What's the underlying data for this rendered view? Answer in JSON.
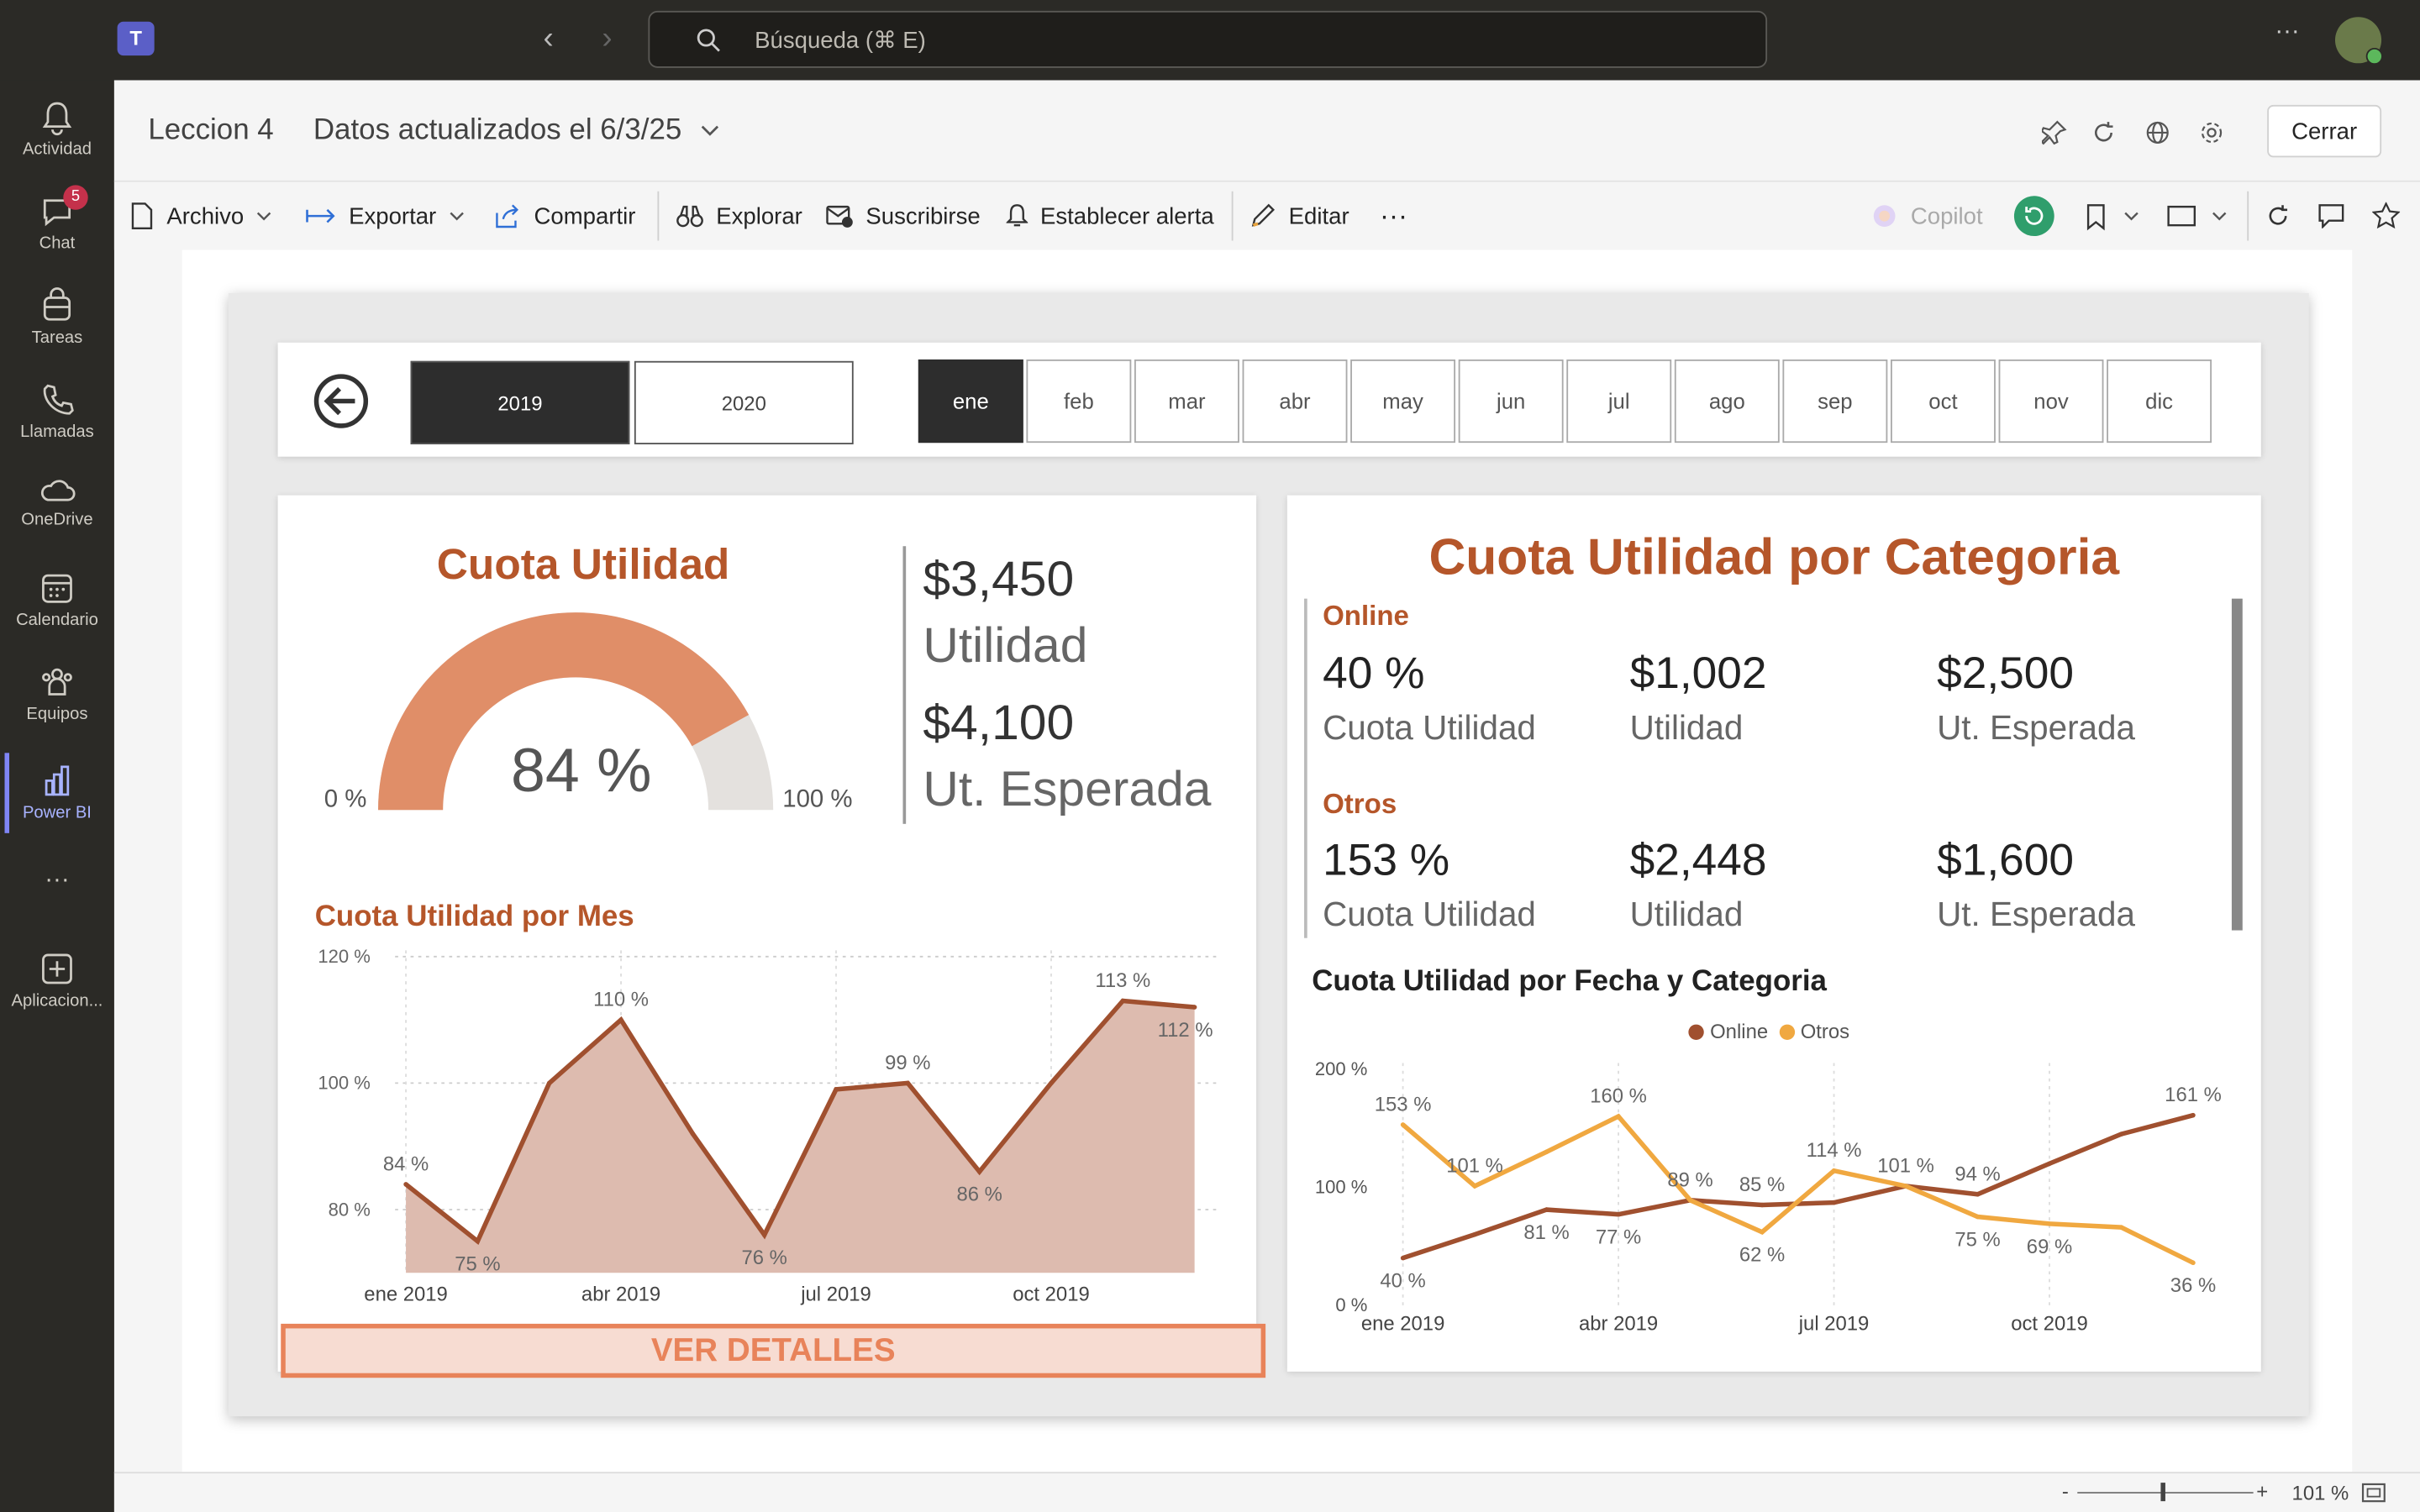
{
  "topbar": {
    "search_placeholder": "Búsqueda (⌘ E)",
    "more": "···"
  },
  "rail": {
    "chat_badge": "5",
    "items": [
      {
        "label": "Actividad"
      },
      {
        "label": "Chat"
      },
      {
        "label": "Tareas"
      },
      {
        "label": "Llamadas"
      },
      {
        "label": "OneDrive"
      },
      {
        "label": "Calendario"
      },
      {
        "label": "Equipos"
      },
      {
        "label": "Power BI"
      },
      {
        "label": "···"
      },
      {
        "label": "Aplicacion..."
      }
    ]
  },
  "header": {
    "title": "Leccion 4",
    "updated": "Datos actualizados el 6/3/25",
    "close_label": "Cerrar"
  },
  "toolbar": {
    "archivo": "Archivo",
    "exportar": "Exportar",
    "compartir": "Compartir",
    "explorar": "Explorar",
    "suscribirse": "Suscribirse",
    "alerta": "Establecer alerta",
    "editar": "Editar",
    "more": "···",
    "copilot": "Copilot"
  },
  "slicer": {
    "years": [
      "2019",
      "2020"
    ],
    "months": [
      "ene",
      "feb",
      "mar",
      "abr",
      "may",
      "jun",
      "jul",
      "ago",
      "sep",
      "oct",
      "nov",
      "dic"
    ],
    "selected_year": "2019",
    "selected_month": "ene"
  },
  "gauge": {
    "title": "Cuota Utilidad",
    "value_label": "84 %",
    "min_label": "0 %",
    "max_label": "100 %",
    "fraction": 0.84
  },
  "kpis": {
    "utilidad_value": "$3,450",
    "utilidad_label": "Utilidad",
    "esperada_value": "$4,100",
    "esperada_label": "Ut. Esperada"
  },
  "categoria": {
    "title": "Cuota Utilidad por Categoria",
    "online": {
      "name": "Online",
      "cuota": "40 %",
      "cuota_label": "Cuota Utilidad",
      "utilidad": "$1,002",
      "utilidad_label": "Utilidad",
      "esperada": "$2,500",
      "esperada_label": "Ut. Esperada"
    },
    "otros": {
      "name": "Otros",
      "cuota": "153 %",
      "cuota_label": "Cuota Utilidad",
      "utilidad": "$2,448",
      "utilidad_label": "Utilidad",
      "esperada": "$1,600",
      "esperada_label": "Ut. Esperada"
    }
  },
  "details_button": "VER DETALLES",
  "status": {
    "zoom": "101 %",
    "minus": "-",
    "plus": "+"
  },
  "colors": {
    "accent": "#b5562a",
    "online": "#a0502f",
    "otros": "#f0a840",
    "gauge_fill": "#e08e68",
    "area_fill": "#ddbbaf"
  },
  "chart_data": [
    {
      "type": "area",
      "title": "Cuota Utilidad por Mes",
      "categories": [
        "ene 2019",
        "feb 2019",
        "mar 2019",
        "abr 2019",
        "may 2019",
        "jun 2019",
        "jul 2019",
        "ago 2019",
        "sep 2019",
        "oct 2019",
        "nov 2019",
        "dic 2019"
      ],
      "values": [
        84,
        75,
        100,
        110,
        92,
        76,
        99,
        100,
        86,
        100,
        113,
        112
      ],
      "data_labels": {
        "0": "84 %",
        "1": "75 %",
        "3": "110 %",
        "5": "76 %",
        "7": "99 %",
        "8": "86 %",
        "10": "113 %",
        "11": "112 %"
      },
      "x_ticks": [
        "ene 2019",
        "abr 2019",
        "jul 2019",
        "oct 2019"
      ],
      "y_ticks": [
        "80 %",
        "100 %",
        "120 %"
      ],
      "ylim": [
        70,
        120
      ],
      "grid": true
    },
    {
      "type": "line",
      "title": "Cuota Utilidad por Fecha y Categoria",
      "categories": [
        "ene 2019",
        "feb 2019",
        "mar 2019",
        "abr 2019",
        "may 2019",
        "jun 2019",
        "jul 2019",
        "ago 2019",
        "sep 2019",
        "oct 2019",
        "nov 2019",
        "dic 2019"
      ],
      "series": [
        {
          "name": "Online",
          "values": [
            40,
            60,
            81,
            77,
            89,
            85,
            87,
            101,
            94,
            120,
            145,
            161
          ]
        },
        {
          "name": "Otros",
          "values": [
            153,
            101,
            130,
            160,
            89,
            62,
            114,
            101,
            75,
            69,
            66,
            36
          ]
        }
      ],
      "data_labels": [
        {
          "series": 0,
          "index": 0,
          "text": "40 %"
        },
        {
          "series": 1,
          "index": 0,
          "text": "153 %"
        },
        {
          "series": 1,
          "index": 1,
          "text": "101 %"
        },
        {
          "series": 0,
          "index": 2,
          "text": "81 %"
        },
        {
          "series": 1,
          "index": 3,
          "text": "160 %"
        },
        {
          "series": 0,
          "index": 3,
          "text": "77 %"
        },
        {
          "series": 0,
          "index": 4,
          "text": "89 %"
        },
        {
          "series": 0,
          "index": 5,
          "text": "85 %"
        },
        {
          "series": 1,
          "index": 5,
          "text": "62 %"
        },
        {
          "series": 1,
          "index": 6,
          "text": "114 %"
        },
        {
          "series": 1,
          "index": 7,
          "text": "101 %"
        },
        {
          "series": 1,
          "index": 8,
          "text": "75 %"
        },
        {
          "series": 0,
          "index": 8,
          "text": "94 %"
        },
        {
          "series": 1,
          "index": 9,
          "text": "69 %"
        },
        {
          "series": 0,
          "index": 11,
          "text": "161 %"
        },
        {
          "series": 1,
          "index": 11,
          "text": "36 %"
        }
      ],
      "x_ticks": [
        "ene 2019",
        "abr 2019",
        "jul 2019",
        "oct 2019"
      ],
      "y_ticks": [
        "0 %",
        "100 %",
        "200 %"
      ],
      "ylim": [
        0,
        200
      ],
      "legend": "top-center",
      "grid": true
    }
  ]
}
